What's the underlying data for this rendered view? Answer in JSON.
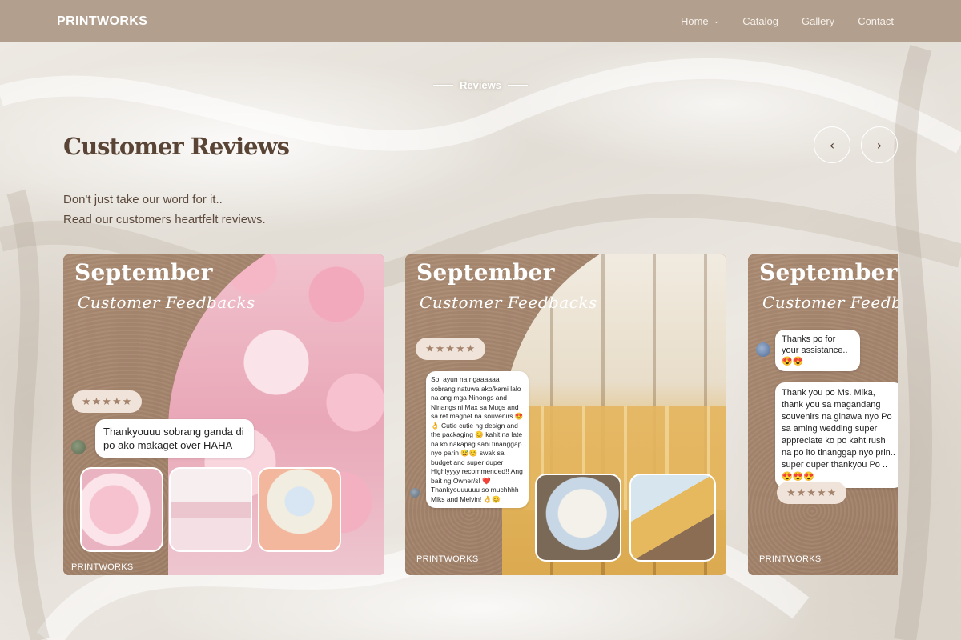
{
  "nav": {
    "brand": "PRINTWORKS",
    "items": [
      {
        "label": "Home",
        "has_dropdown": true
      },
      {
        "label": "Catalog"
      },
      {
        "label": "Gallery"
      },
      {
        "label": "Contact"
      }
    ]
  },
  "section": {
    "eyebrow": "Reviews",
    "title": "Customer Reviews",
    "subtitle_line1": "Don't just take our word for it..",
    "subtitle_line2": "Read our customers heartfelt reviews."
  },
  "carousel": {
    "prev_icon": "chevron-left-icon",
    "next_icon": "chevron-right-icon",
    "cards": [
      {
        "month": "September",
        "script": "Customer Feedbacks",
        "stars": "★★★★★",
        "review": "Thankyouuu sobrang ganda di po ako makaget over HAHA",
        "brand": "PRINTWORKS"
      },
      {
        "month": "September",
        "script": "Customer Feedbacks",
        "stars": "★★★★★",
        "review": "So, ayun na ngaaaaaa sobrang natuwa ako/kami lalo na ang mga Ninongs and Ninangs ni Max sa Mugs and sa ref magnet na souvenirs 😍👌 Cutie cutie ng design and the packaging 😊 kahit na late na ko nakapag sabi tinanggap nyo parin 😅😊 swak sa budget and super duper Highlyyyy recommended!! Ang bait ng Owner/s! ❤️ Thankyouuuuuu so muchhhh Miks and Melvin! 👌😊",
        "brand": "PRINTWORKS"
      },
      {
        "month": "September",
        "script": "Customer Feedbacks",
        "stars": "★★★★★",
        "review_1": "Thanks po for your assistance.. 😍😍",
        "review_2": "Thank you po Ms. Mika, thank you sa magandang souvenirs na ginawa nyo Po sa aming wedding super appreciate ko po kaht rush na po ito tinanggap nyo prin.. super duper thankyou Po .. 😍😍😍",
        "brand": "PRINTWORKS"
      }
    ]
  },
  "colors": {
    "nav_bg": "#b29f8d",
    "title": "#5a4435",
    "card_bg": "#a3836a"
  }
}
